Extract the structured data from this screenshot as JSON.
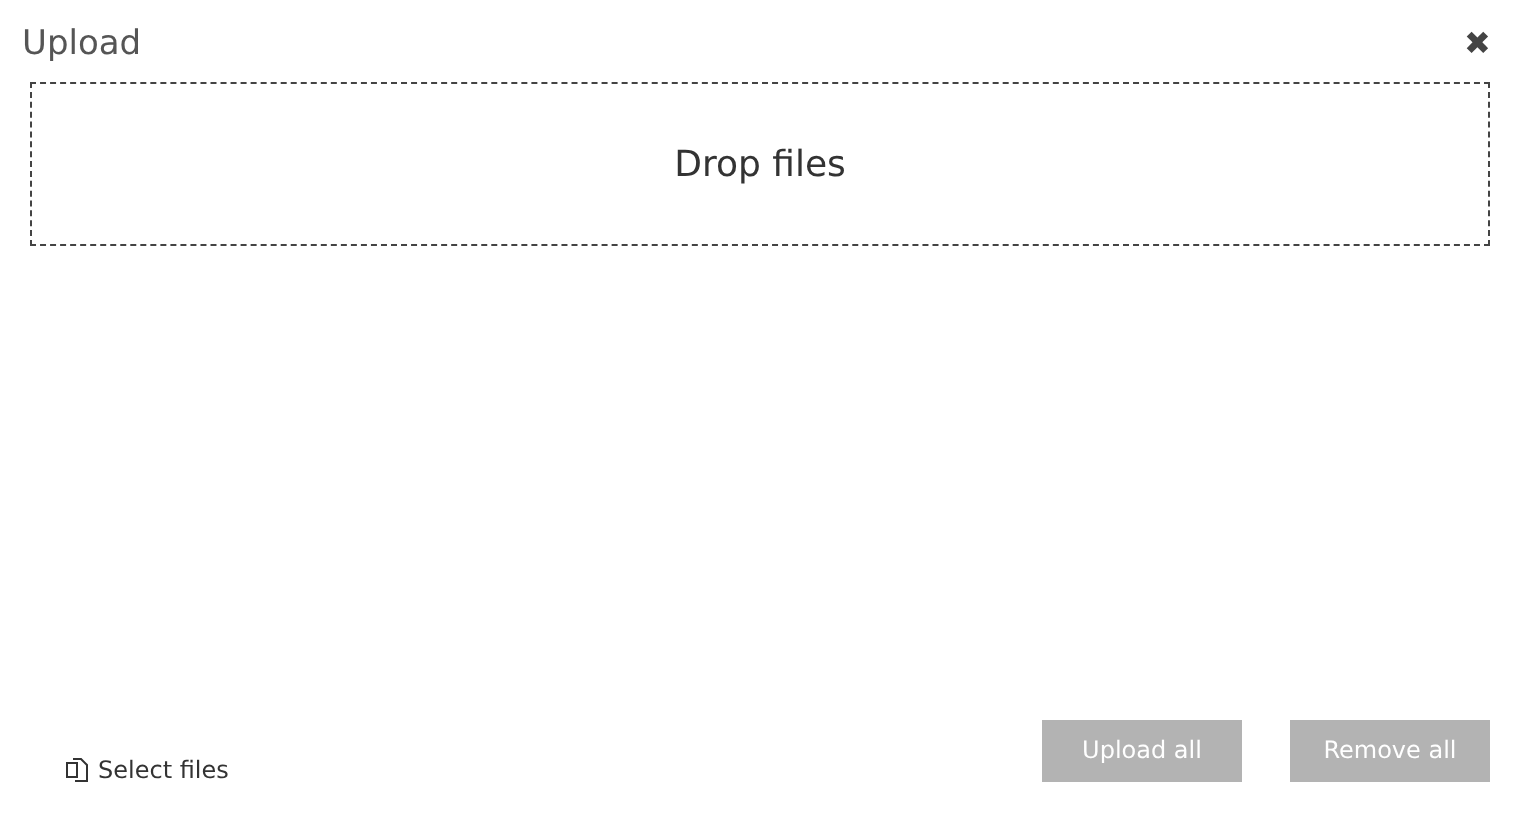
{
  "dialog": {
    "title": "Upload",
    "close": "✖"
  },
  "dropzone": {
    "label": "Drop files"
  },
  "select_files": {
    "label": "Select files"
  },
  "buttons": [
    {
      "label": "Upload all",
      "disabled": true
    },
    {
      "label": "Remove all",
      "disabled": true
    }
  ]
}
